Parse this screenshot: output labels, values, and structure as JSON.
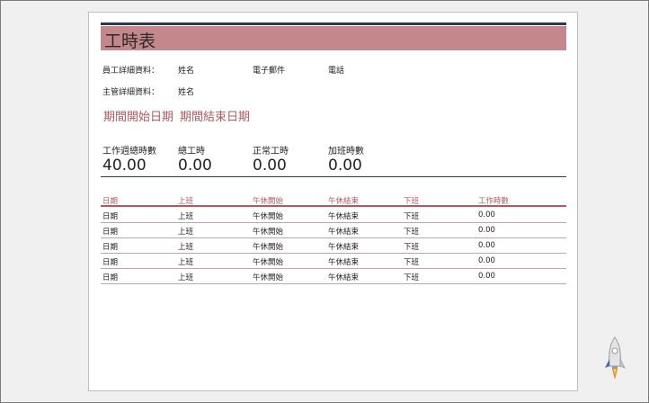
{
  "document": {
    "title": "工時表",
    "employee_details_label": "員工詳細資料：",
    "manager_details_label": "主管詳細資料：",
    "employee_name_label": "姓名",
    "employee_email_label": "電子郵件",
    "employee_phone_label": "電話",
    "manager_name_label": "姓名",
    "period_start": "期間開始日期",
    "period_end": "期間結束日期"
  },
  "summary": {
    "weekly_hours_label": "工作週總時數",
    "weekly_hours_value": "40.00",
    "total_hours_label": "總工時",
    "total_hours_value": "0.00",
    "regular_hours_label": "正常工時",
    "regular_hours_value": "0.00",
    "overtime_hours_label": "加班時數",
    "overtime_hours_value": "0.00"
  },
  "table": {
    "headers": [
      "日期",
      "上班",
      "午休開始",
      "午休結束",
      "下班",
      "工作時數"
    ],
    "rows": [
      [
        "日期",
        "上班",
        "午休開始",
        "午休結束",
        "下班",
        "0.00"
      ],
      [
        "日期",
        "上班",
        "午休開始",
        "午休結束",
        "下班",
        "0.00"
      ],
      [
        "日期",
        "上班",
        "午休開始",
        "午休結束",
        "下班",
        "0.00"
      ],
      [
        "日期",
        "上班",
        "午休開始",
        "午休結束",
        "下班",
        "0.00"
      ],
      [
        "日期",
        "上班",
        "午休開始",
        "午休結束",
        "下班",
        "0.00"
      ]
    ]
  },
  "colors": {
    "accent": "#c4878b",
    "accent_text": "#b05a5e",
    "rule": "#2e3a4a"
  },
  "icons": {
    "corner_logo": "rocket-icon"
  }
}
